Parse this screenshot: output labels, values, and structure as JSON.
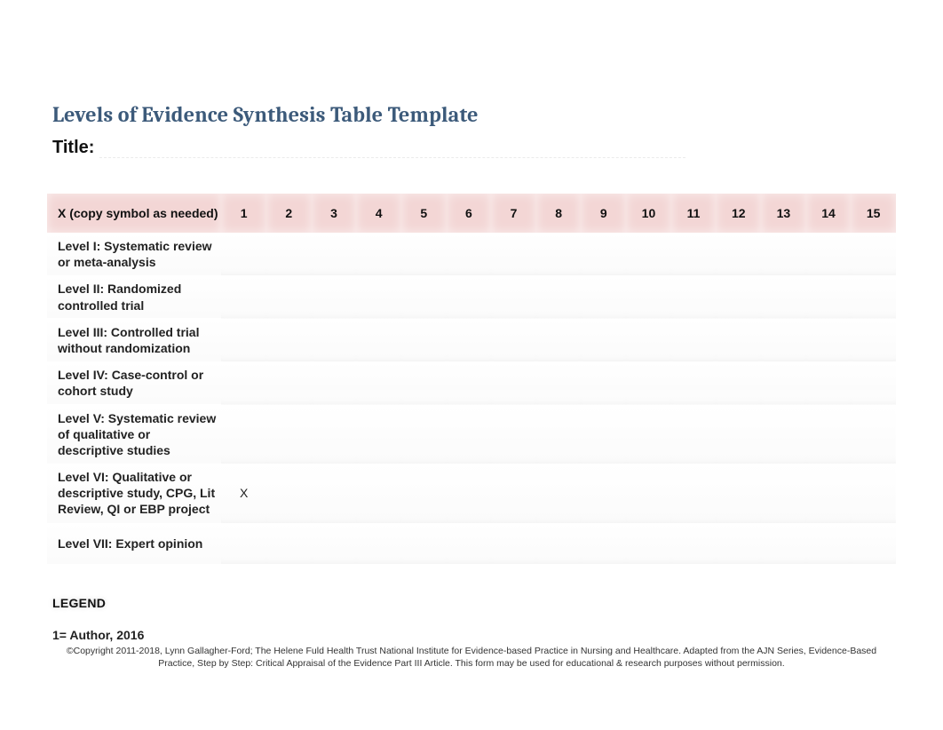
{
  "heading": "Levels of Evidence Synthesis Table Template",
  "title_label": "Title:",
  "table": {
    "label_header": "X (copy symbol as needed)",
    "columns": [
      "1",
      "2",
      "3",
      "4",
      "5",
      "6",
      "7",
      "8",
      "9",
      "10",
      "11",
      "12",
      "13",
      "14",
      "15"
    ],
    "rows": [
      {
        "label": "Level  I: Systematic review or meta-analysis",
        "cells": [
          "",
          "",
          "",
          "",
          "",
          "",
          "",
          "",
          "",
          "",
          "",
          "",
          "",
          "",
          ""
        ]
      },
      {
        "label": "Level  II: Randomized controlled trial",
        "cells": [
          "",
          "",
          "",
          "",
          "",
          "",
          "",
          "",
          "",
          "",
          "",
          "",
          "",
          "",
          ""
        ]
      },
      {
        "label": "Level  III: Controlled trial without randomization",
        "cells": [
          "",
          "",
          "",
          "",
          "",
          "",
          "",
          "",
          "",
          "",
          "",
          "",
          "",
          "",
          ""
        ]
      },
      {
        "label": "Level  IV: Case-control or cohort study",
        "cells": [
          "",
          "",
          "",
          "",
          "",
          "",
          "",
          "",
          "",
          "",
          "",
          "",
          "",
          "",
          ""
        ]
      },
      {
        "label": "Level V: Systematic review of qualitative or descriptive studies",
        "cells": [
          "",
          "",
          "",
          "",
          "",
          "",
          "",
          "",
          "",
          "",
          "",
          "",
          "",
          "",
          ""
        ]
      },
      {
        "label": "Level VI: Qualitative or descriptive study, CPG, Lit Review, QI or EBP project",
        "cells": [
          "X",
          "",
          "",
          "",
          "",
          "",
          "",
          "",
          "",
          "",
          "",
          "",
          "",
          "",
          ""
        ]
      },
      {
        "label": "Level  VII: Expert opinion",
        "cells": [
          "",
          "",
          "",
          "",
          "",
          "",
          "",
          "",
          "",
          "",
          "",
          "",
          "",
          "",
          ""
        ]
      }
    ]
  },
  "legend": {
    "heading": "LEGEND",
    "items": [
      "1= Author, 2016"
    ]
  },
  "copyright": "©Copyright 2011-2018, Lynn Gallagher-Ford; The Helene Fuld Health Trust National Institute for Evidence-based Practice in Nursing and Healthcare. Adapted from the AJN Series, Evidence-Based Practice, Step by Step: Critical Appraisal of the Evidence Part III Article. This form may be used for educational & research purposes without permission."
}
